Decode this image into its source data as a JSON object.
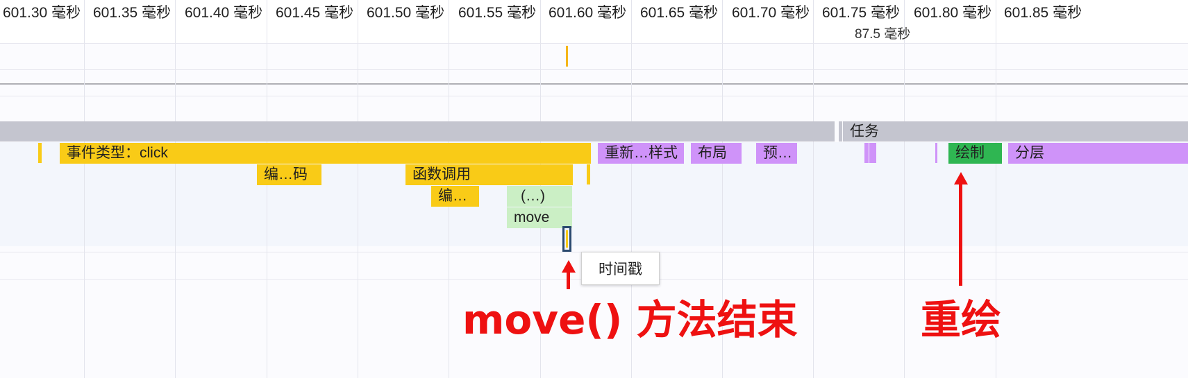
{
  "ruler": {
    "ticks": [
      "601.30 毫秒",
      "601.35 毫秒",
      "601.40 毫秒",
      "601.45 毫秒",
      "601.50 毫秒",
      "601.55 毫秒",
      "601.60 毫秒",
      "601.65 毫秒",
      "601.70 毫秒",
      "601.75 毫秒",
      "601.80 毫秒",
      "601.85 毫秒"
    ],
    "duration": "87.5 毫秒"
  },
  "colors": {
    "task": "#c4c5cf",
    "scripting": "#f9cb17",
    "rendering": "#cf93f9",
    "painting": "#2fb652",
    "function": "#cbefc5"
  },
  "flame": {
    "task_label": "任务",
    "event_label": "事件类型：click",
    "recalc_style_label": "重新…样式",
    "layout_label": "布局",
    "prepaint_label": "预…",
    "paint_label": "绘制",
    "layerize_label": "分层",
    "compile1_label": "编…码",
    "function_call_label": "函数调用",
    "compile2_label": "编…",
    "anon_label": "(…)",
    "move_label": "move"
  },
  "tooltip": {
    "text": "时间戳"
  },
  "annotations": {
    "move_end": "move() 方法结束",
    "repaint": "重绘"
  }
}
